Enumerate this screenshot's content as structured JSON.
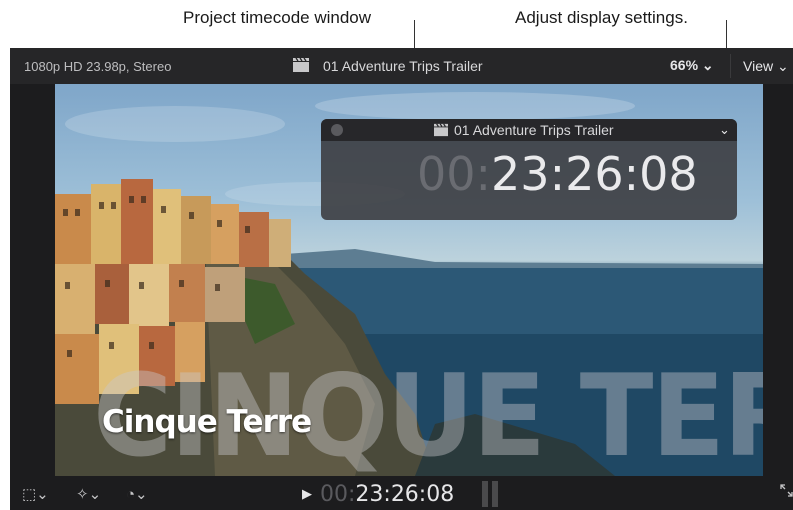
{
  "callouts": {
    "timecode_window": "Project timecode window",
    "display_settings": "Adjust display settings."
  },
  "topbar": {
    "format": "1080p HD 23.98p, Stereo",
    "project_title": "01 Adventure Trips Trailer",
    "zoom": "66% ⌄",
    "view": "View ⌄"
  },
  "viewer": {
    "big_title": "CINQUE TERRE",
    "subtitle": "Cinque Terre"
  },
  "timecode_window": {
    "title": "01 Adventure Trips Trailer",
    "chevron": "⌄",
    "timecode_dim": "00:",
    "timecode": "23:26:08"
  },
  "bottombar": {
    "play": "▶",
    "timecode_dim": "00:",
    "timecode": "23:26:08"
  }
}
